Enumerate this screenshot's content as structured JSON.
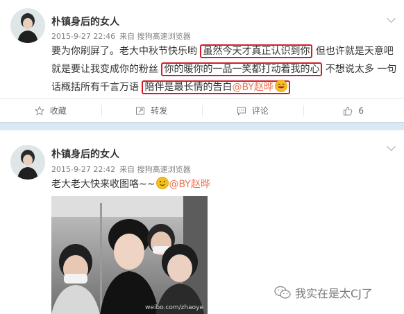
{
  "post1": {
    "user_name": "朴镇身后的女人",
    "date": "2015-9-27 22:46",
    "source": "来自 搜狗高速浏览器",
    "line1_a": "要为你刷屏了。老大中秋节快乐哟 ",
    "line1_hl": "虽然今天才真正认识到你",
    "line1_b": " 但也许就是天意吧",
    "line2_a": "就是要让我变成你的粉丝 ",
    "line2_hl": "你的暖你的一品一笑都打动着我的心",
    "line2_b": " 不想说太多 一句",
    "line3_a": "话概括所有千言万语 ",
    "line3_hl": "陪伴是最长情的告白",
    "mention": "@BY赵晔",
    "actions": {
      "favorite": "收藏",
      "repost": "转发",
      "comment": "评论",
      "like_count": "6"
    }
  },
  "post2": {
    "user_name": "朴镇身后的女人",
    "date": "2015-9-27 22:42",
    "source": "来自 搜狗高速浏览器",
    "text": "老大老大快来收图咯~~",
    "mention": "@BY赵晔",
    "photo_watermark": "weibo.com/zhaoye"
  },
  "watermark": "我实在是太CJ了",
  "colors": {
    "mention": "#eb7350",
    "highlight_box": "#d31c2b",
    "separator": "#d9e8f3"
  }
}
